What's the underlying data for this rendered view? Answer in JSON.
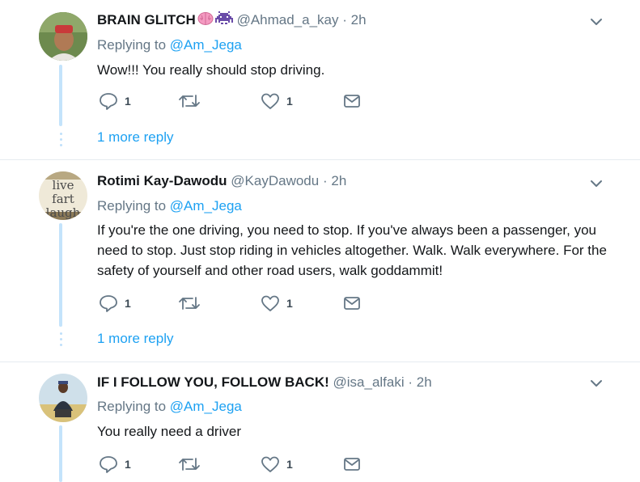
{
  "colors": {
    "accent": "#1da1f2",
    "muted": "#657786",
    "thread": "#c4e3fb",
    "divider": "#e6ecf0"
  },
  "tweets": [
    {
      "name": "BRAIN GLITCH",
      "name_icons": [
        "brain-icon",
        "alien-monster-icon"
      ],
      "handle": "@Ahmad_a_kay",
      "separator": "·",
      "time": "2h",
      "replying_prefix": "Replying to",
      "replying_to": "@Am_Jega",
      "text": "Wow!!! You really should stop driving.",
      "reply_count": "1",
      "retweet_count": "",
      "like_count": "1",
      "more_replies": "1 more reply"
    },
    {
      "name": "Rotimi Kay-Dawodu",
      "handle": "@KayDawodu",
      "separator": "·",
      "time": "2h",
      "replying_prefix": "Replying to",
      "replying_to": "@Am_Jega",
      "text": "If you're the one driving, you need to stop. If you've always been a passenger, you need to stop. Just stop riding in vehicles altogether. Walk. Walk everywhere. For the safety of yourself and other road users, walk goddammit!",
      "avatar_text": [
        "live",
        "fart",
        "laugh"
      ],
      "reply_count": "1",
      "retweet_count": "",
      "like_count": "1",
      "more_replies": "1 more reply"
    },
    {
      "name": "IF I FOLLOW YOU, FOLLOW BACK!",
      "handle": "@isa_alfaki",
      "separator": "·",
      "time": "2h",
      "replying_prefix": "Replying to",
      "replying_to": "@Am_Jega",
      "text": "You really need a driver",
      "reply_count": "1",
      "retweet_count": "",
      "like_count": "1"
    }
  ]
}
